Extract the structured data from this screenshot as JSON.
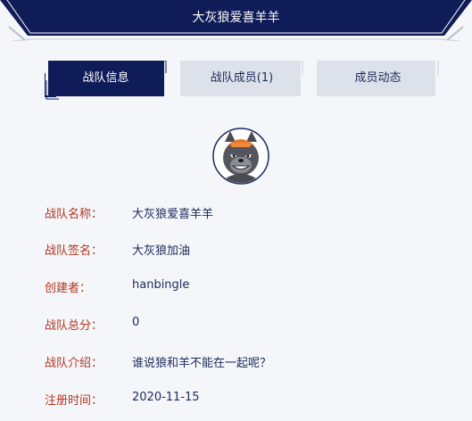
{
  "header": {
    "title": "大灰狼爱喜羊羊"
  },
  "tabs": [
    {
      "label": "战队信息",
      "active": true
    },
    {
      "label": "战队成员(1)",
      "active": false
    },
    {
      "label": "成员动态",
      "active": false
    }
  ],
  "avatar": {
    "icon": "wolf-avatar-icon"
  },
  "fields": [
    {
      "label": "战队名称：",
      "value": "大灰狼爱喜羊羊"
    },
    {
      "label": "战队签名：",
      "value": "大灰狼加油"
    },
    {
      "label": "创建者：",
      "value": "hanbingle"
    },
    {
      "label": "战队总分：",
      "value": "0"
    },
    {
      "label": "战队介绍：",
      "value": "谁说狼和羊不能在一起呢？"
    },
    {
      "label": "注册时间：",
      "value": "2020-11-15"
    }
  ],
  "colors": {
    "navy": "#0f1c57",
    "label_red": "#b3341f",
    "value_navy": "#1b2a5a",
    "tab_inactive": "#dde1ea",
    "background": "#f4f6f9"
  }
}
